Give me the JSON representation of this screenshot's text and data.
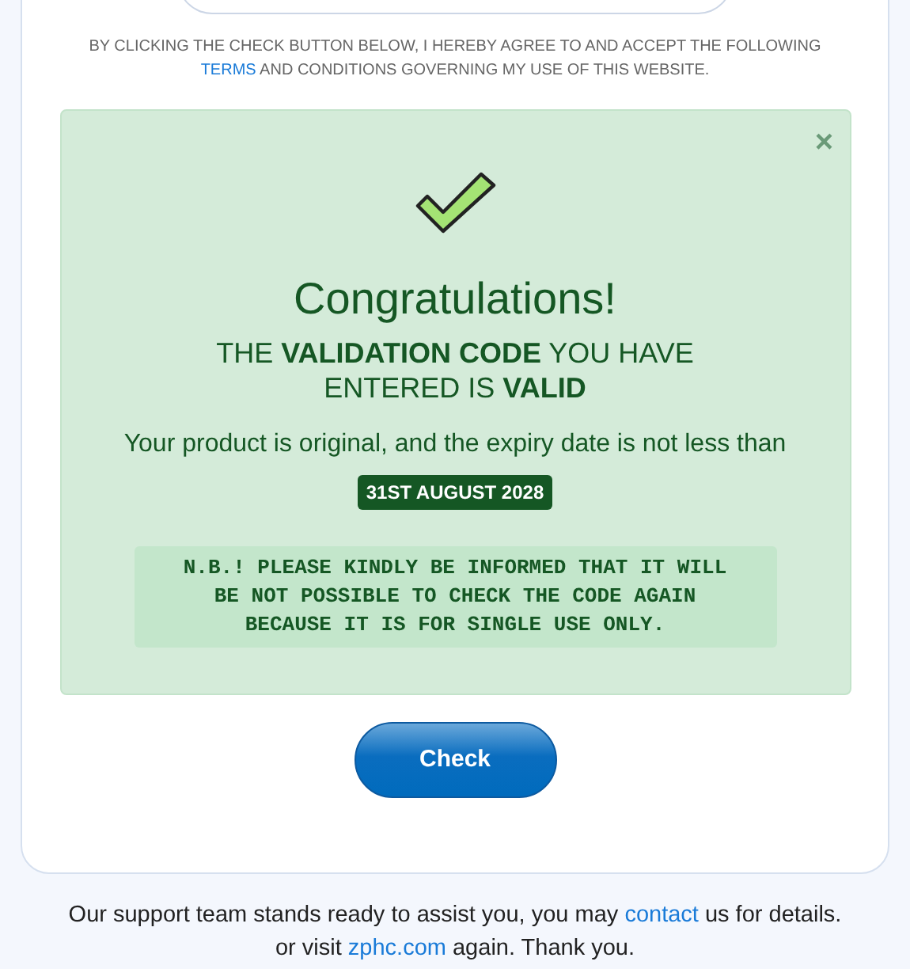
{
  "terms_notice": {
    "before": "BY CLICKING THE CHECK BUTTON BELOW, I HEREBY AGREE TO AND ACCEPT THE FOLLOWING ",
    "link": "TERMS",
    "after": " AND CONDITIONS GOVERNING MY USE OF THIS WEBSITE."
  },
  "alert": {
    "close": "×",
    "title": "Congratulations!",
    "message": "THE **VALIDATION CODE** YOU HAVE ENTERED IS **VALID**",
    "detail": "Your product is original, and the expiry date is not less than",
    "expiry": "31ST AUGUST 2028",
    "note": "N.B.! PLEASE KINDLY BE INFORMED THAT IT WILL BE NOT POSSIBLE TO CHECK THE CODE AGAIN BECAUSE IT IS FOR SINGLE USE ONLY."
  },
  "check_button": "Check",
  "footer": {
    "line1_before": "Our support team stands ready to assist you, you may ",
    "line1_link": "contact",
    "line1_after": " us for details.",
    "line2_before": "or visit ",
    "line2_link": "zphc.com",
    "line2_after": " again. Thank you."
  }
}
